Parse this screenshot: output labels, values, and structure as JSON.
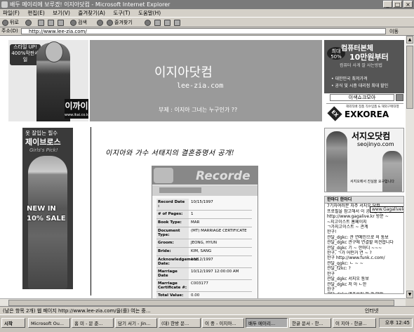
{
  "window": {
    "title": "배두 메이리에 보루겠! 이지아닷컴 - Microsoft Internet Explorer",
    "controls": [
      "_",
      "□",
      "×"
    ]
  },
  "menu": [
    "파일(F)",
    "편집(E)",
    "보기(V)",
    "즐겨찾기(A)",
    "도구(T)",
    "도움말(H)"
  ],
  "toolbar": {
    "back": "뒤로",
    "search": "검색",
    "favorites": "즐겨찾기"
  },
  "address": {
    "label": "주소(D)",
    "url": "http://www.lee-zia.com/",
    "go": "이동"
  },
  "ads": {
    "left_top": {
      "badge": "스타일 UP! 400%막판세일",
      "brand": "이까이",
      "brand_url": "www.ikai.co.kr"
    },
    "right_top": {
      "pct": "최대 50%",
      "line1": "컴퓨터본체",
      "line2": "10만원부터",
      "line3": "컴퓨터 사게 잘 사는방법",
      "bullet1": "• 대한민국 최저가격",
      "bullet2": "• 공식 및 시중 대리점 최대 할인"
    },
    "search_placeholder": "이색쇼크모아",
    "exkorea": {
      "tag": "해외직배 정품 직수입품 & 해외구매대행",
      "mark": "EX",
      "name": "EXKOREA"
    },
    "left_tall": {
      "t1": "옷 잘입는 필수",
      "t2": "제이브로스",
      "t3": "Girls's Pick!",
      "t4": "NEW IN",
      "t5": "10% SALE"
    },
    "right_mid": {
      "title": "서지오닷컴",
      "domain": "seojinyo.com",
      "caption": "서지오에서 진실을 요구합니다"
    }
  },
  "banner": {
    "logo": "이지아닷컴",
    "domain": "lee-zia.com",
    "subtitle": "부제 : 이지아 그녀는 누구인가 ??"
  },
  "article": {
    "headline": "이지아와 가수 서태지의 결혼증명서 공개!"
  },
  "record": {
    "title": "Recorde",
    "rows": [
      {
        "k": "Record Date :",
        "v": "10/15/1997"
      },
      {
        "k": "# of Pages:",
        "v": "1"
      },
      {
        "k": "Book Type:",
        "v": "MAR"
      },
      {
        "k": "Document Type:",
        "v": "(MT) MARRIAGE CERTIFICATE"
      },
      {
        "k": "Groom:",
        "v": "JEONG, HYUN"
      },
      {
        "k": "Bride:",
        "v": "KIM, SANG"
      },
      {
        "k": "Acknowledgement Date:",
        "v": "10/12/1997"
      },
      {
        "k": "Marriage Date",
        "v": "10/12/1997 12:00:00 AM"
      },
      {
        "k": "Marriage Certificate #:",
        "v": "C003177"
      },
      {
        "k": "Total Value:",
        "v": "0.00"
      }
    ]
  },
  "guestbook": {
    "header": "한마디 한마디",
    "tooltip": "www.Gagalivelo",
    "lines": [
      "7기자여러분 자주 서지오 닷컴",
      "프로필을 참고해서 이 공개를 통하",
      "http://www.gagalive.kr 방문 ~",
      "~지고이스트 홈페이지",
      "ㄱ가지고이스트 ~ 관계",
      "한구!",
      "관달_dgkc: 관 연예인으로 의 통보",
      "관달_dgkc 관구에 연결할 의견합니다",
      "관달_dgkc 기 ~ 한마디 ~~~",
      "한구, ㄱ가 어떤거 연 ~ ?",
      "한구 http://www.funk.c.com/",
      "관달_qgkc: ㄴ ~ ~",
      "관달_f2kc: ?",
      "한구",
      "관달_dgkc 서지오 통보",
      "관달_dgkc 저 아 ㄴ한",
      "한구",
      "관달_dgkc 연조쓰러 해 관 발왕",
      "관달_dgkc 문제점 중 해 상세",
      "그램접 한 코트 ~ 관련 ~ 관련 중일"
    ]
  },
  "status": {
    "text": "(남은 항목 2개) 웹 페이지 http://www.lee-zia.com/을(를) 여는 중...",
    "zone": "인터넷"
  },
  "taskbar": {
    "buttons": [
      "시작",
      "Microsoft Ou...",
      "홈 미 - 문 준...",
      "담기 서기 - Jin...",
      "(대) 한방 문...",
      "이 중 - 이지아...",
      "배두 메이리...",
      "한글 문서 - 한...",
      "이 지아 - 한글..."
    ],
    "clock": "오후 12:45"
  }
}
